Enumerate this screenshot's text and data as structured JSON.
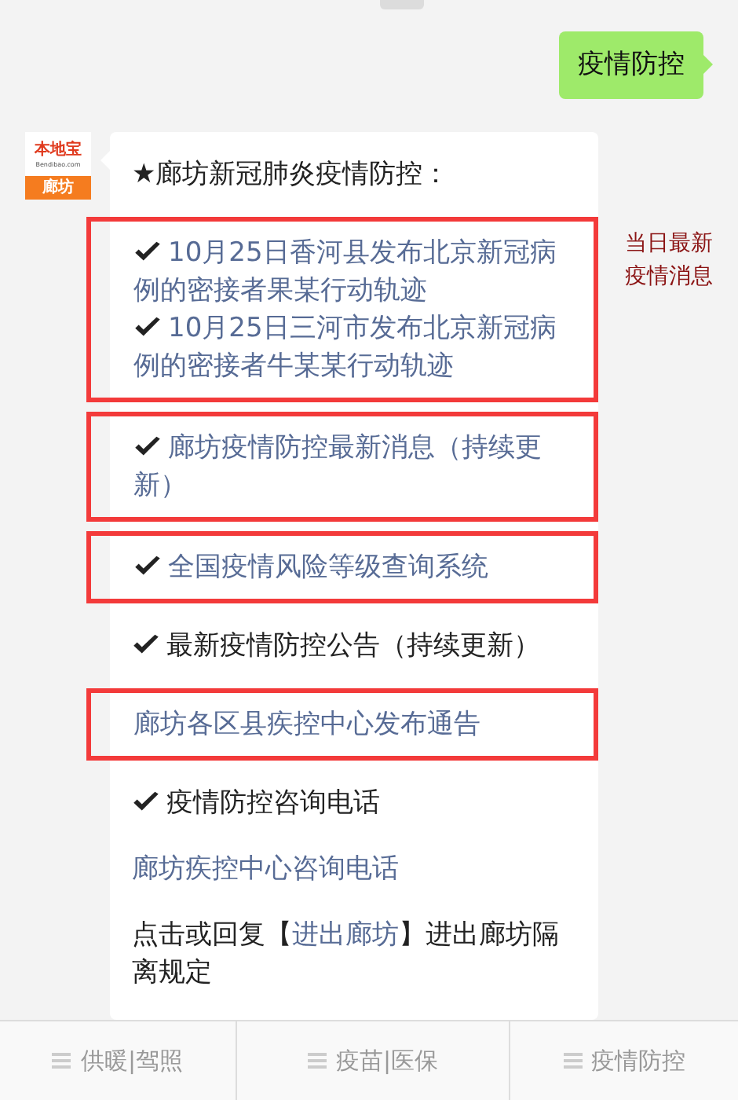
{
  "sent_message": {
    "text": "疫情防控"
  },
  "reply": {
    "avatar": {
      "brand": "本地宝",
      "site": "Bendibao.com",
      "city": "廊坊"
    },
    "blocks": [
      {
        "highlighted": false,
        "lines": [
          {
            "kind": "header",
            "text": "★廊坊新冠肺炎疫情防控："
          }
        ]
      },
      {
        "highlighted": true,
        "lines": [
          {
            "kind": "check-link",
            "text": "10月25日香河县发布北京新冠病例的密接者果某行动轨迹"
          },
          {
            "kind": "check-link",
            "text": "10月25日三河市发布北京新冠病例的密接者牛某某行动轨迹"
          }
        ]
      },
      {
        "highlighted": true,
        "lines": [
          {
            "kind": "check-link",
            "text": "廊坊疫情防控最新消息（持续更新）"
          }
        ]
      },
      {
        "highlighted": true,
        "lines": [
          {
            "kind": "check-link",
            "text": "全国疫情风险等级查询系统"
          }
        ]
      },
      {
        "highlighted": false,
        "lines": [
          {
            "kind": "check-heading",
            "text": "最新疫情防控公告（持续更新）"
          }
        ]
      },
      {
        "highlighted": true,
        "lines": [
          {
            "kind": "link",
            "text": "廊坊各区县疾控中心发布通告"
          }
        ]
      },
      {
        "highlighted": false,
        "lines": [
          {
            "kind": "check-heading",
            "text": "疫情防控咨询电话"
          }
        ]
      },
      {
        "highlighted": false,
        "lines": [
          {
            "kind": "link",
            "text": "廊坊疾控中心咨询电话"
          }
        ]
      },
      {
        "highlighted": false,
        "lines": [
          {
            "kind": "mixed",
            "before": "点击或回复【",
            "link": "进出廊坊",
            "after": "】进出廊坊隔离规定"
          }
        ]
      }
    ]
  },
  "annotation": {
    "text": "当日最新疫情消息"
  },
  "menu": [
    {
      "label": "供暖|驾照"
    },
    {
      "label": "疫苗|医保"
    },
    {
      "label": "疫情防控"
    }
  ]
}
